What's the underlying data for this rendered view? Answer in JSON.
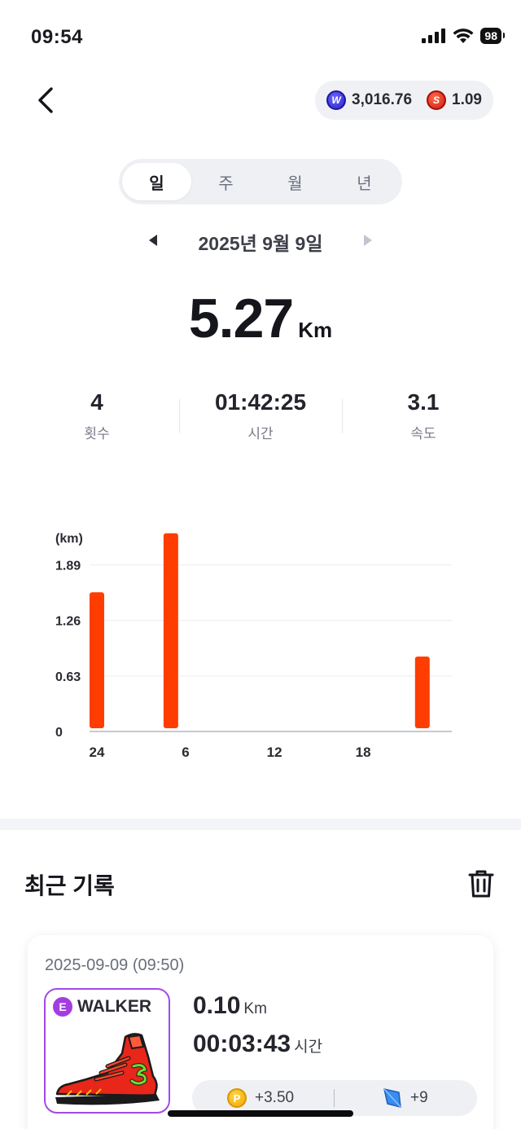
{
  "status_bar": {
    "time": "09:54",
    "battery": "98",
    "icons": [
      "cellular-signal-icon",
      "wifi-icon",
      "battery-icon"
    ]
  },
  "header": {
    "back_icon": "chevron-left-icon",
    "currencies": [
      {
        "icon": "w-coin-icon",
        "glyph": "W",
        "value": "3,016.76",
        "color": "#3b34e0"
      },
      {
        "icon": "s-coin-icon",
        "glyph": "S",
        "value": "1.09",
        "color": "#e2261b"
      }
    ]
  },
  "period_tabs": [
    {
      "label": "일",
      "active": true
    },
    {
      "label": "주",
      "active": false
    },
    {
      "label": "월",
      "active": false
    },
    {
      "label": "년",
      "active": false
    }
  ],
  "date_nav": {
    "date": "2025년 9월 9일",
    "prev_icon": "triangle-left-icon",
    "next_icon": "triangle-right-icon"
  },
  "summary": {
    "distance": "5.27",
    "distance_unit": "Km",
    "stats": [
      {
        "value": "4",
        "label": "횟수"
      },
      {
        "value": "01:42:25",
        "label": "시간"
      },
      {
        "value": "3.1",
        "label": "속도"
      }
    ]
  },
  "chart_data": {
    "type": "bar",
    "ylabel": "(km)",
    "y_ticks": [
      "0",
      "0.63",
      "1.26",
      "1.89"
    ],
    "y_tick_values": [
      0,
      0.63,
      1.26,
      1.89
    ],
    "x_ticks": [
      "24",
      "6",
      "12",
      "18"
    ],
    "x_tick_hours": [
      0,
      6,
      12,
      18
    ],
    "x_range": [
      0,
      23
    ],
    "ylim": [
      0,
      2.2
    ],
    "bar_color": "#ff3d00",
    "bars": [
      {
        "hour": 0,
        "value": 1.58
      },
      {
        "hour": 5,
        "value": 2.25
      },
      {
        "hour": 22,
        "value": 0.85
      }
    ],
    "grid": true
  },
  "recent": {
    "title": "최근 기록",
    "trash_icon": "trash-icon",
    "records": [
      {
        "datetime": "2025-09-09 (09:50)",
        "shoe_grade": "E",
        "shoe_type": "WALKER",
        "shoe_image": "red-sneaker-illustration",
        "distance": "0.10",
        "distance_unit": "Km",
        "duration": "00:03:43",
        "duration_unit": "시간",
        "rewards": [
          {
            "icon": "p-coin-icon",
            "glyph": "P",
            "value": "+3.50"
          },
          {
            "icon": "blue-gem-icon",
            "value": "+9"
          }
        ]
      }
    ]
  }
}
